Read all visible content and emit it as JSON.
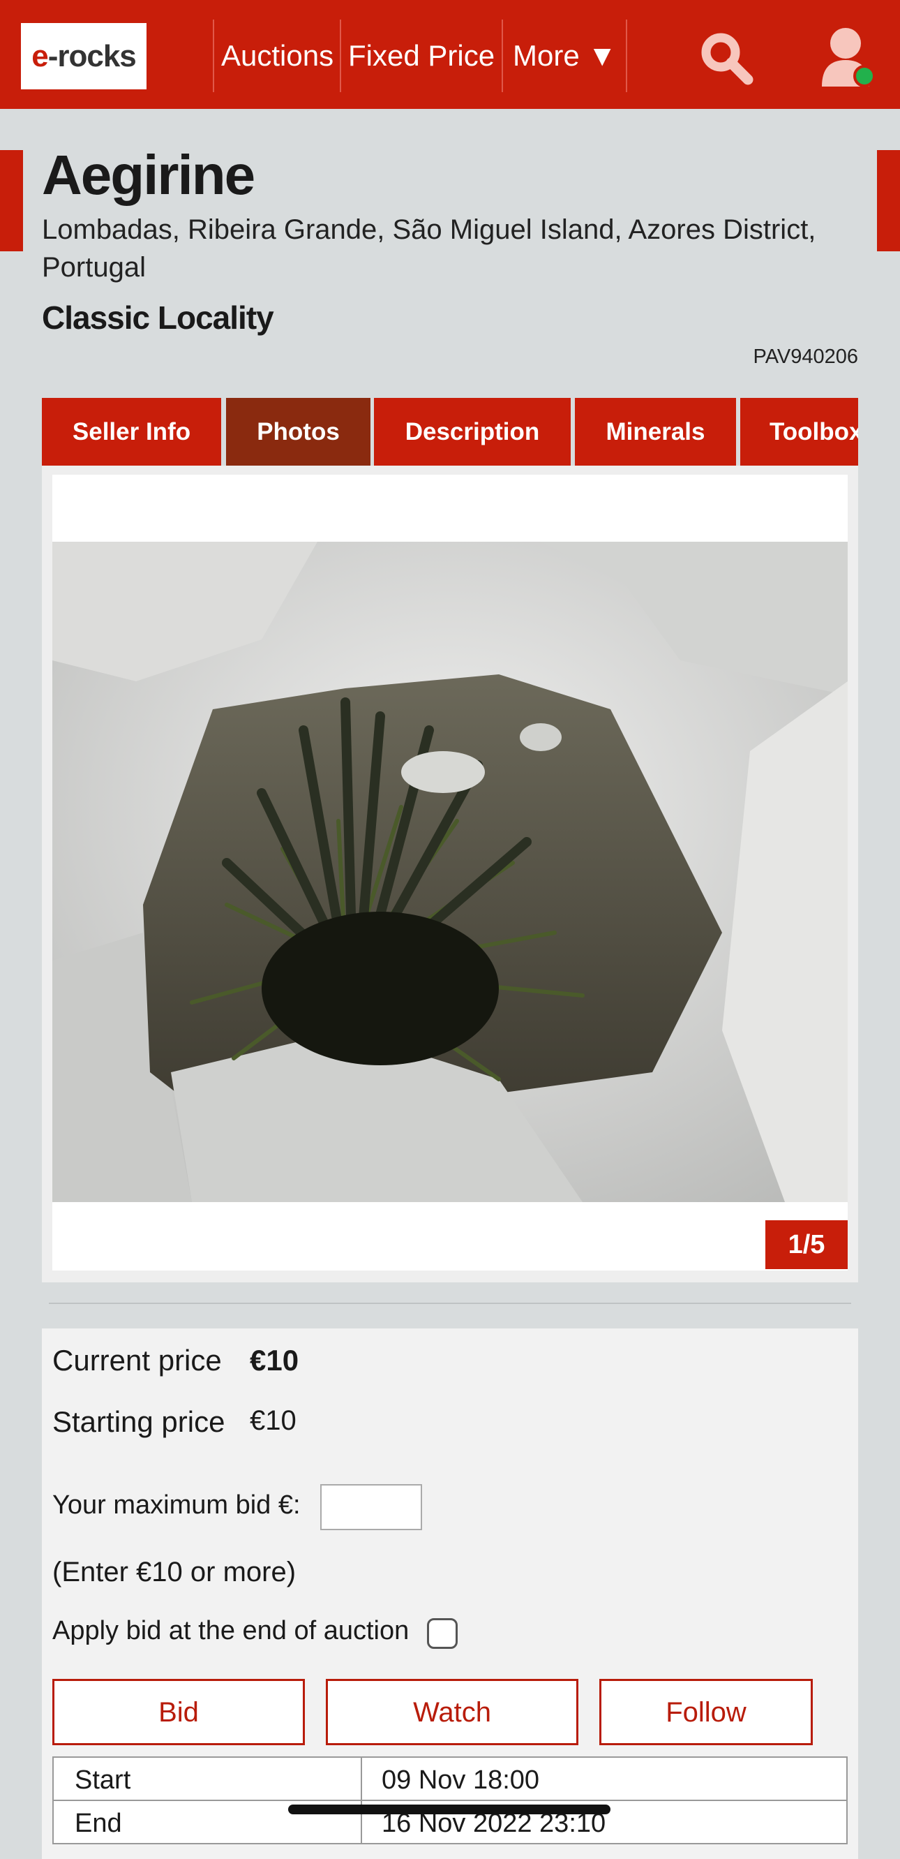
{
  "header": {
    "logo_e": "e",
    "logo_rest": "-rocks",
    "nav": [
      "Auctions",
      "Fixed Price",
      "More ▼"
    ],
    "brand_color": "#c81e0a",
    "online_status_color": "#22b14c"
  },
  "listing": {
    "title": "Aegirine",
    "locality": "Lombadas, Ribeira Grande, São Miguel Island, Azores District, Portugal",
    "classic": "Classic Locality",
    "ref": "PAV940206"
  },
  "tabs": [
    {
      "label": "Seller Info"
    },
    {
      "label": "Photos",
      "active": true
    },
    {
      "label": "Description"
    },
    {
      "label": "Minerals"
    },
    {
      "label": "Toolbox"
    }
  ],
  "photo": {
    "counter": "1/5",
    "subject": "specimen-photo"
  },
  "bid": {
    "current_label": "Current price",
    "current_value": "€10",
    "starting_label": "Starting price",
    "starting_value": "€10",
    "max_bid_label": "Your maximum bid €:",
    "max_bid_value": "",
    "hint": "(Enter €10 or more)",
    "apply_label": "Apply bid at the end of auction",
    "buttons": {
      "bid": "Bid",
      "watch": "Watch",
      "follow": "Follow"
    }
  },
  "table": [
    {
      "label": "Start",
      "value": "09 Nov 18:00"
    },
    {
      "label": "End",
      "value": "16 Nov 2022 23:10"
    }
  ]
}
